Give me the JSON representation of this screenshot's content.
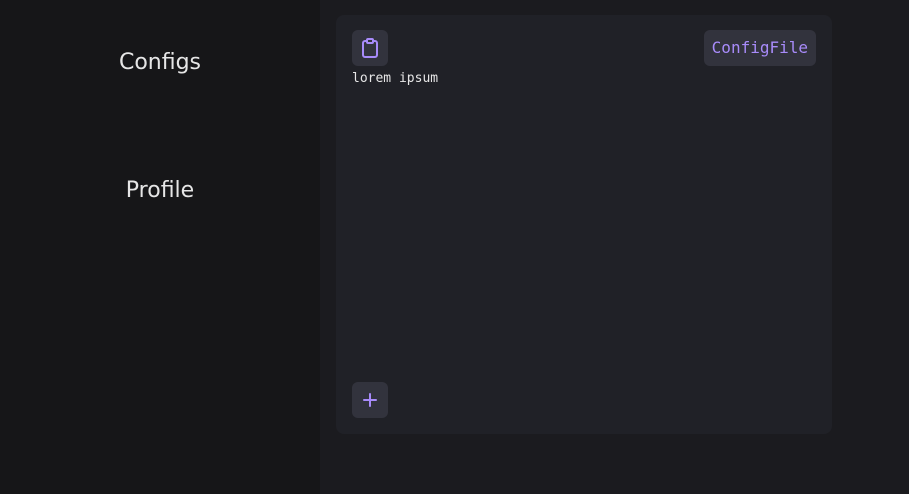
{
  "sidebar": {
    "items": [
      {
        "label": "Configs"
      },
      {
        "label": "Profile"
      }
    ]
  },
  "card": {
    "tag_label": "ConfigFile",
    "content": "lorem ipsum",
    "copy_icon": "clipboard-icon",
    "add_icon": "plus-icon"
  },
  "colors": {
    "sidebar_bg": "#161618",
    "main_bg": "#1b1b1f",
    "card_bg": "#202127",
    "button_bg": "#32333d",
    "accent": "#a88bfa",
    "text": "#e6e6e6"
  }
}
